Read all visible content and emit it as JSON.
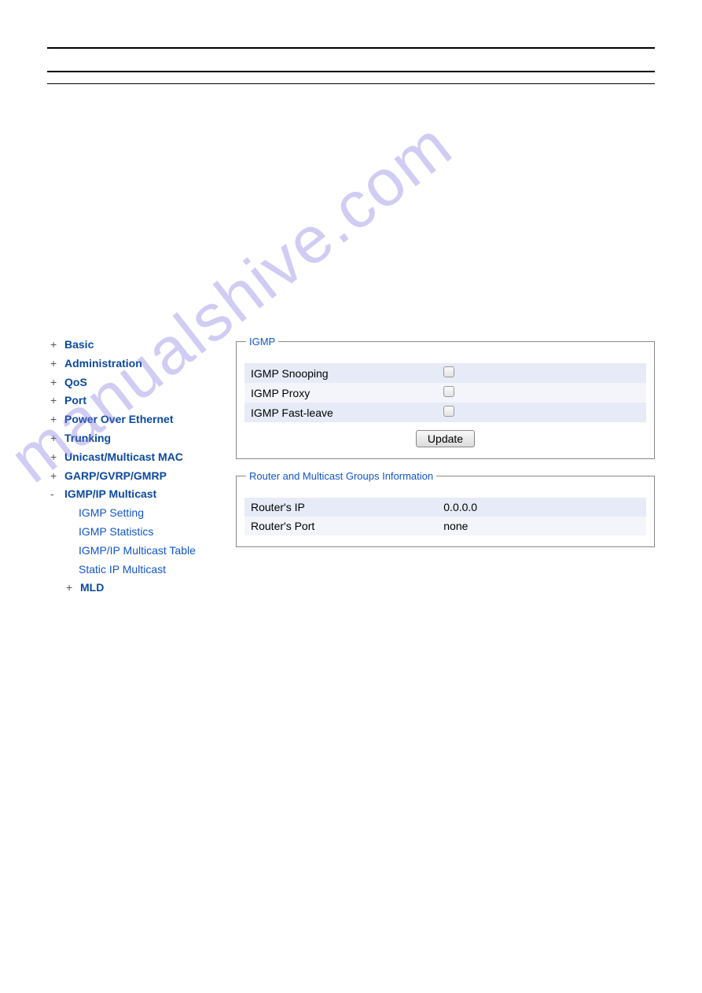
{
  "sidebar": {
    "items": [
      {
        "sign": "+",
        "label": "Basic"
      },
      {
        "sign": "+",
        "label": "Administration"
      },
      {
        "sign": "+",
        "label": "QoS"
      },
      {
        "sign": "+",
        "label": "Port"
      },
      {
        "sign": "+",
        "label": "Power Over Ethernet"
      },
      {
        "sign": "+",
        "label": "Trunking"
      },
      {
        "sign": "+",
        "label": "Unicast/Multicast MAC"
      },
      {
        "sign": "+",
        "label": "GARP/GVRP/GMRP"
      },
      {
        "sign": "-",
        "label": "IGMP/IP Multicast"
      }
    ],
    "subitems": [
      "IGMP Setting",
      "IGMP Statistics",
      "IGMP/IP Multicast Table",
      "Static IP Multicast"
    ],
    "mld": {
      "sign": "+",
      "label": "MLD"
    }
  },
  "igmp_panel": {
    "legend": "IGMP",
    "rows": [
      "IGMP Snooping",
      "IGMP Proxy",
      "IGMP Fast-leave"
    ],
    "update_label": "Update"
  },
  "router_panel": {
    "legend": "Router and Multicast Groups Information",
    "rows": [
      {
        "k": "Router's IP",
        "v": "0.0.0.0"
      },
      {
        "k": "Router's Port",
        "v": "none"
      }
    ]
  },
  "watermark": "manualshive.com"
}
